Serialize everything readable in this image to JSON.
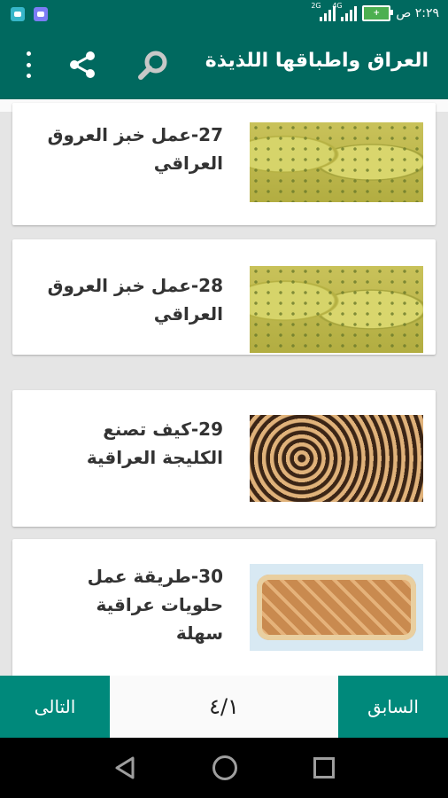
{
  "statusbar": {
    "time": "٢:٢٩ ص",
    "signal1_label": "2G",
    "signal2_label": "4G",
    "battery_label": "+"
  },
  "appbar": {
    "title": "العراق واطباقها اللذيذة"
  },
  "items": [
    {
      "text": "27-عمل خبز العروق العراقي",
      "image": "bread"
    },
    {
      "text": "28-عمل خبز العروق العراقي",
      "image": "bread"
    },
    {
      "text": "29-كيف تصنع الكليجة العراقية",
      "image": "rolls"
    },
    {
      "text": "30-طريقة عمل حلويات عراقية سهلة",
      "image": "tray"
    }
  ],
  "pager": {
    "next_label": "التالى",
    "prev_label": "السابق",
    "page_indicator": "٤/١"
  },
  "colors": {
    "primary": "#00695f",
    "button": "#00897b"
  }
}
